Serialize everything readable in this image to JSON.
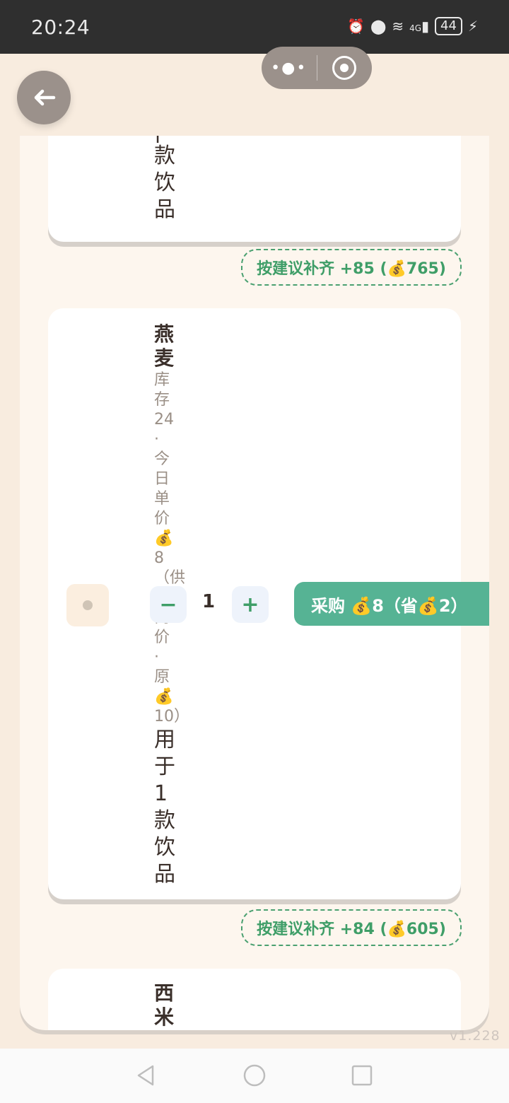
{
  "status_bar": {
    "time": "20:24",
    "battery": "44",
    "signal_labels": "4G"
  },
  "card1": {
    "tail_chars": [
      "款",
      "饮",
      "品"
    ]
  },
  "suggest1": {
    "label": "按建议补齐 +85 (💰765)"
  },
  "item2": {
    "name_chars": [
      "燕",
      "麦"
    ],
    "detail_chars": [
      "库",
      "存",
      "24",
      "·",
      "今",
      "日",
      "单",
      "价",
      "💰",
      "8",
      "（供",
      "应",
      "商",
      "价",
      "·",
      "原",
      "💰",
      "10）"
    ],
    "use_chars": [
      "用",
      "于",
      "1",
      "款",
      "饮",
      "品"
    ],
    "quantity": "1",
    "minus_label": "−",
    "plus_label": "+",
    "buy_label": "采购 💰8（省💰2）"
  },
  "suggest2": {
    "label": "按建议补齐 +84 (💰605)"
  },
  "item3": {
    "name_chars": [
      "西",
      "米"
    ]
  },
  "version": "v1.228",
  "colors": {
    "accent": "#56b394",
    "suggest": "#3f9e68",
    "page_bg": "#f8ecdf"
  }
}
